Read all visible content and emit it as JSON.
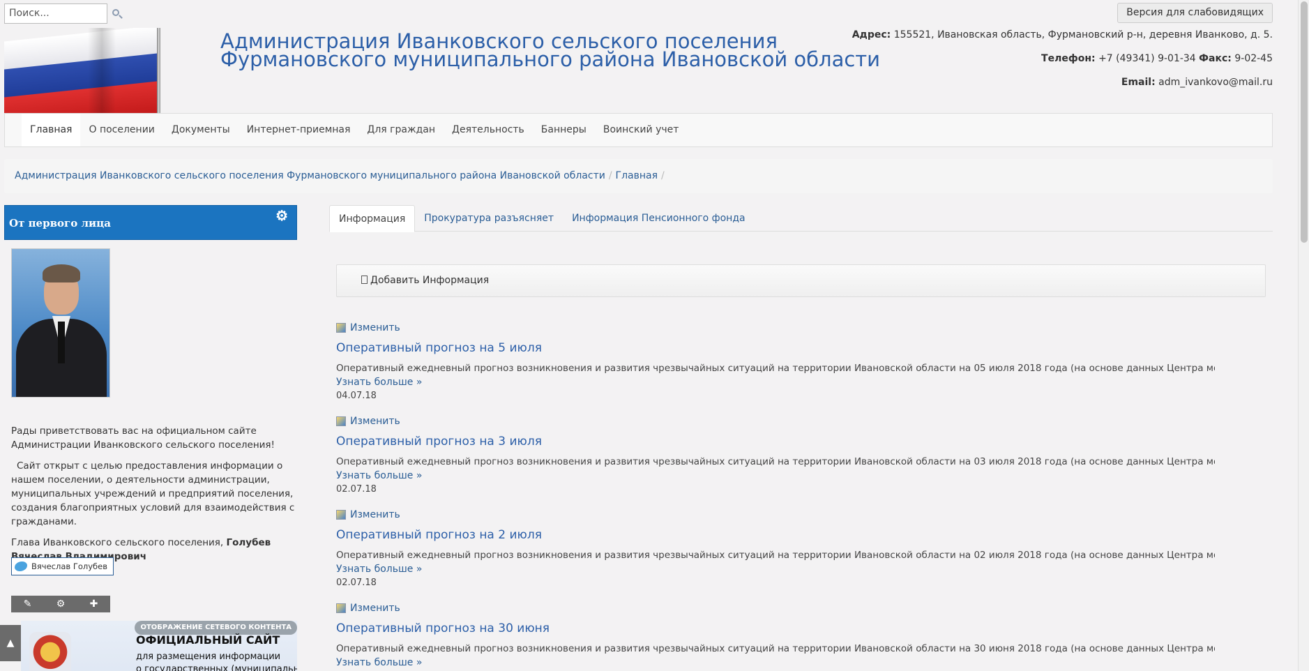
{
  "search": {
    "placeholder": "Поиск..."
  },
  "vision_button": "Версия для слабовидящих",
  "site_title": {
    "line1": "Администрация Иванковского сельского поселения",
    "line2": "Фурмановского муниципального района Ивановской области"
  },
  "contacts": {
    "address_label": "Адрес:",
    "address": "155521, Ивановская область, Фурмановский р-н, деревня Иванково, д. 5.",
    "phone_label": "Телефон:",
    "phone": "+7 (49341) 9-01-34",
    "fax_label": "Факс:",
    "fax": "9-02-45",
    "email_label": "Email:",
    "email": "adm_ivankovo@mail.ru"
  },
  "nav": [
    {
      "label": "Главная"
    },
    {
      "label": "О поселении"
    },
    {
      "label": "Документы"
    },
    {
      "label": "Интернет-приемная"
    },
    {
      "label": "Для граждан"
    },
    {
      "label": "Деятельность"
    },
    {
      "label": "Баннеры"
    },
    {
      "label": "Воинский учет"
    }
  ],
  "breadcrumb": {
    "root": "Администрация Иванковского сельского поселения Фурмановского муниципального района Ивановской области",
    "current": "Главная",
    "separator": "/"
  },
  "sidebar": {
    "header": "От первого лица",
    "welcome": "Рады приветствовать вас на официальном сайте Администрации Иванковского сельского поселения!",
    "about": "Сайт открыт с целью предоставления информации о нашем поселении, о деятельности администрации, муниципальных учреждений и предприятий поселения, создания благоприятных условий для взаимодействия с гражданами.",
    "head_prefix": "Глава Иванковского сельского поселения,",
    "head_name": "Голубев Вячеслав Владимирович",
    "twitter_label": "Вячеслав Голубев",
    "banner": {
      "tag": "ОТОБРАЖЕНИЕ СЕТЕВОГО КОНТЕНТА",
      "title": "ОФИЦИАЛЬНЫЙ САЙТ",
      "sub1": "для размещения информации",
      "sub2": "о государственных (муниципальных)"
    }
  },
  "tabs": [
    {
      "label": "Информация"
    },
    {
      "label": "Прокуратура разъясняет"
    },
    {
      "label": "Информация Пенсионного фонда"
    }
  ],
  "add_label": "Добавить Информация",
  "news": [
    {
      "edit": "Изменить",
      "title": "Оперативный прогноз на 5 июля",
      "excerpt": "Оперативный ежедневный прогноз возникновения и развития чрезвычайных ситуаций на территории Ивановской области на 05 июля 2018 года (на основе данных Центра мониторинга и...",
      "more": "Узнать больше »",
      "date": "04.07.18"
    },
    {
      "edit": "Изменить",
      "title": "Оперативный прогноз на 3 июля",
      "excerpt": "Оперативный ежедневный прогноз возникновения и развития чрезвычайных ситуаций на территории Ивановской области на 03 июля 2018 года (на основе данных Центра мониторинга и...",
      "more": "Узнать больше »",
      "date": "02.07.18"
    },
    {
      "edit": "Изменить",
      "title": "Оперативный прогноз на 2 июля",
      "excerpt": "Оперативный ежедневный прогноз возникновения и развития чрезвычайных ситуаций на территории Ивановской области на 02 июля 2018 года (на основе данных Центра мониторинга и...",
      "more": "Узнать больше »",
      "date": "02.07.18"
    },
    {
      "edit": "Изменить",
      "title": "Оперативный прогноз на 30 июня",
      "excerpt": "Оперативный ежедневный прогноз возникновения и развития чрезвычайных ситуаций на территории Ивановской области на 30 июня 2018 года (на основе данных Центра мониторинга и...",
      "more": "Узнать больше »"
    }
  ],
  "scroll_top": "▲"
}
